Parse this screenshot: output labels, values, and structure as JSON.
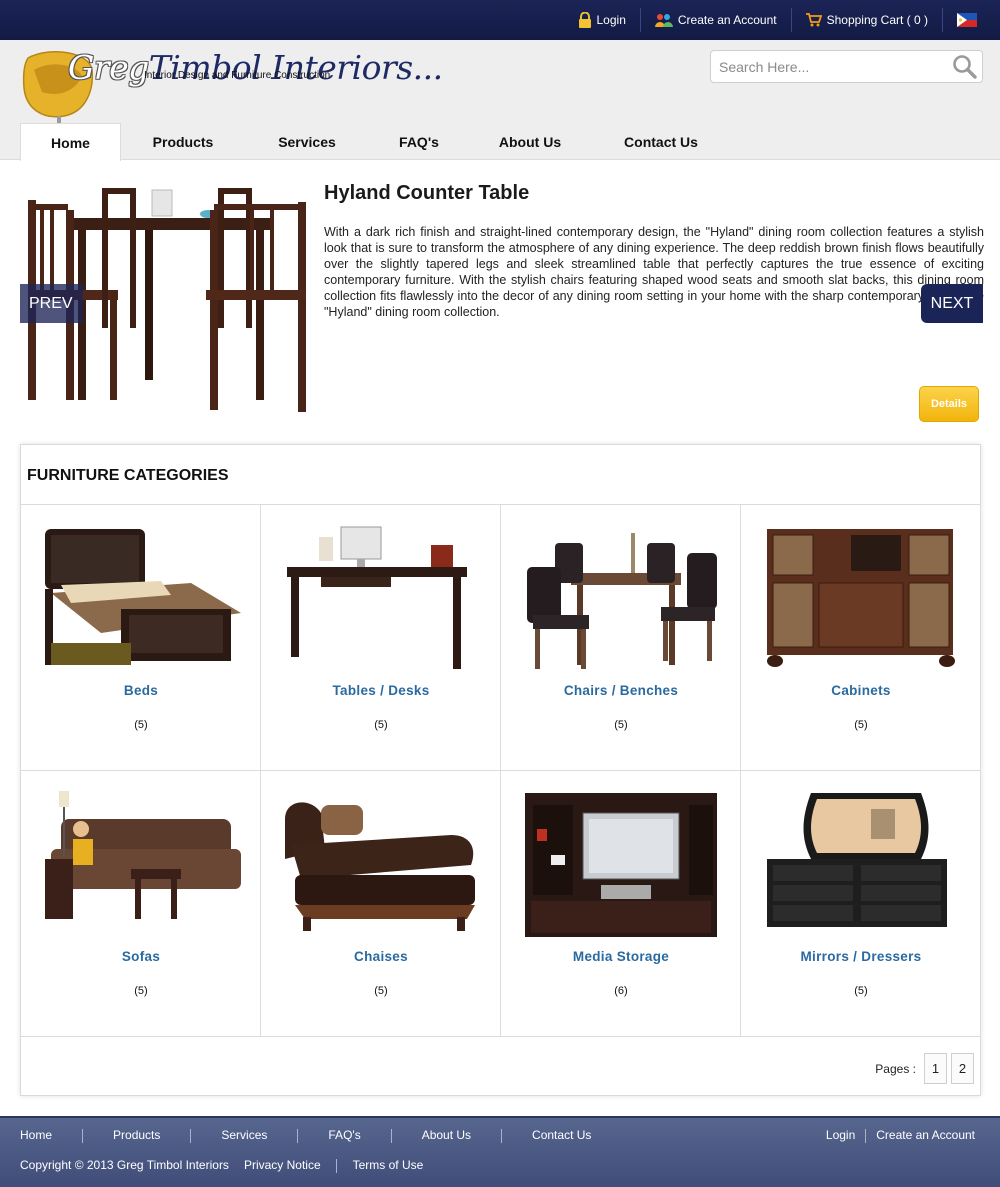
{
  "topbar": {
    "login": "Login",
    "create_account": "Create an Account",
    "cart": "Shopping Cart ( 0 )"
  },
  "header": {
    "logo_first": "Greg",
    "logo_rest": "Timbol Interiors...",
    "tagline": "Interior Design and Furniture Construction",
    "search_placeholder": "Search Here..."
  },
  "nav": {
    "tabs": [
      "Home",
      "Products",
      "Services",
      "FAQ's",
      "About Us",
      "Contact Us"
    ],
    "active": "Home"
  },
  "feature": {
    "title": "Hyland Counter Table",
    "description": "With a dark rich finish and straight-lined contemporary design, the \"Hyland\" dining room collection features a stylish look that is sure to transform the atmosphere of any dining experience. The deep reddish brown finish flows beautifully over the slightly tapered legs and sleek streamlined table that perfectly captures the true essence of exciting contemporary furniture. With the stylish chairs featuring shaped wood seats and smooth slat backs, this dining room collection fits flawlessly into the decor of any dining room setting in your home with the sharp contemporary flair of the \"Hyland\" dining room collection.",
    "prev": "PREV",
    "next": "NEXT",
    "details": "Details"
  },
  "categories": {
    "title": "FURNITURE CATEGORIES",
    "items": [
      {
        "name": "Beds",
        "count": "(5)"
      },
      {
        "name": "Tables / Desks",
        "count": "(5)"
      },
      {
        "name": "Chairs / Benches",
        "count": "(5)"
      },
      {
        "name": "Cabinets",
        "count": "(5)"
      },
      {
        "name": "Sofas",
        "count": "(5)"
      },
      {
        "name": "Chaises",
        "count": "(5)"
      },
      {
        "name": "Media Storage",
        "count": "(6)"
      },
      {
        "name": "Mirrors / Dressers",
        "count": "(5)"
      }
    ],
    "pages_label": "Pages :",
    "pages": [
      "1",
      "2"
    ]
  },
  "footer": {
    "links": [
      "Home",
      "Products",
      "Services",
      "FAQ's",
      "About Us",
      "Contact Us"
    ],
    "login": "Login",
    "create_account": "Create an Account",
    "copyright": "Copyright © 2013 Greg Timbol Interiors",
    "privacy": "Privacy Notice",
    "terms": "Terms of Use"
  },
  "colors": {
    "topbar": "#1b2456",
    "accent_link": "#2a6aa0",
    "details_button": "#f2b40c",
    "footer": "#4a5882"
  }
}
